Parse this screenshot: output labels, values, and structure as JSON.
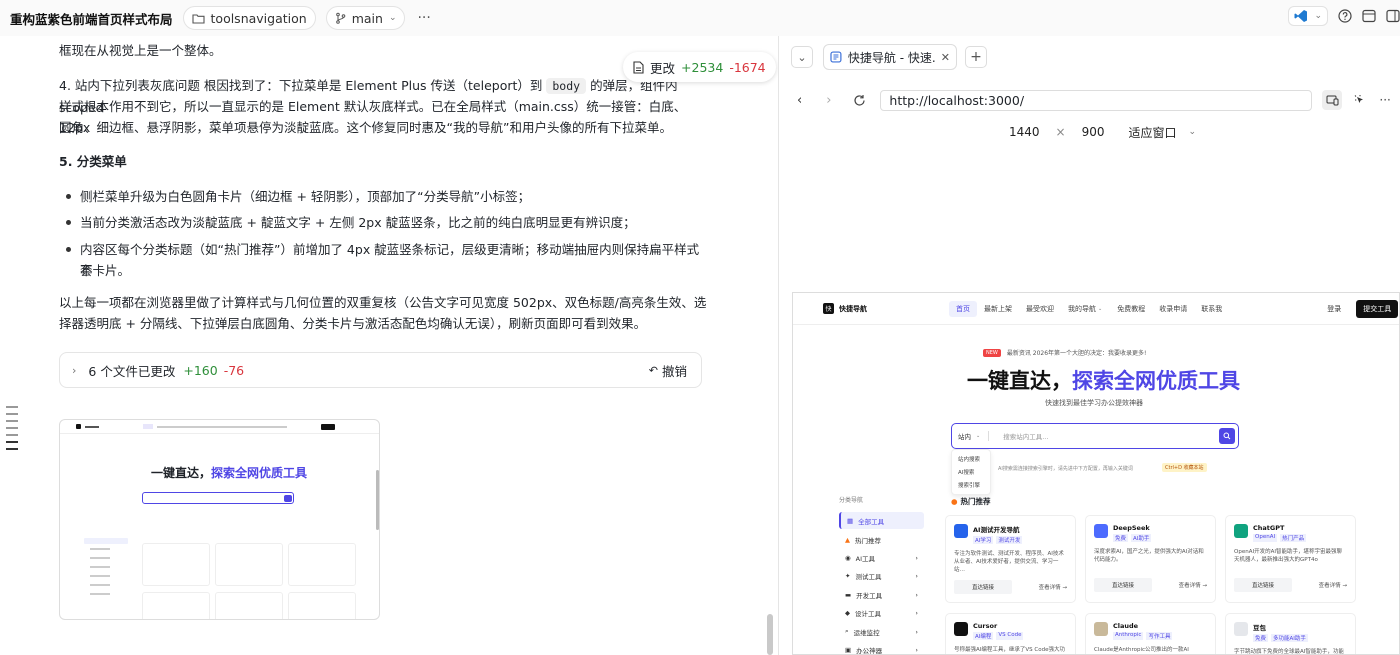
{
  "topbar": {
    "title": "重构蓝紫色前端首页样式布局",
    "folder": "toolsnavigation",
    "branch": "main",
    "more": "···"
  },
  "chat": {
    "p_top": "框现在从视觉上是一个整体。",
    "p4_label": "4. 站内下拉列表灰底问题",
    "p4_a": "根因找到了：下拉菜单是 Element Plus 传送（teleport）到",
    "p4_code": "body",
    "p4_b": "的弹层，组件内 scoped",
    "p4_line2": "样式根本作用不到它，所以一直显示的是 Element 默认灰底样式。已在全局样式（main.css）统一接管：白底、12px",
    "p4_line3": "圆角、细边框、悬浮阴影，菜单项悬停为淡靛蓝底。这个修复同时惠及“我的导航”和用户头像的所有下拉菜单。",
    "p5_label": "5. 分类菜单",
    "bullets": [
      "侧栏菜单升级为白色圆角卡片（细边框 + 轻阴影），顶部加了“分类导航”小标签；",
      "当前分类激活态改为淡靛蓝底 + 靛蓝文字 + 左侧 2px 靛蓝竖条，比之前的纯白底明显更有辨识度；",
      "内容区每个分类标题（如“热门推荐”）前增加了 4px 靛蓝竖条标记，层级更清晰；移动端抽屉内则保持扁平样式不",
      "套卡片。"
    ],
    "summary_line1": "以上每一项都在浏览器里做了计算样式与几何位置的双重复核（公告文字可见宽度 502px、双色标题/高亮条生效、选",
    "summary_line2": "择器透明底 + 分隔线、下拉弹层白底圆角、分类卡片与激活态配色均确认无误），刷新页面即可看到效果。",
    "changes_pill": {
      "label": "更改",
      "added": "+2534",
      "removed": "-1674"
    },
    "files_bar": {
      "label": "6 个文件已更改",
      "added": "+160",
      "removed": "-76",
      "undo": "撤销"
    }
  },
  "browser": {
    "tab_title": "快捷导航 - 快速.",
    "url": "http://localhost:3000/",
    "width": "1440",
    "times": "×",
    "height": "900",
    "fit": "适应窗口"
  },
  "site": {
    "logo": "快捷导航",
    "nav": [
      "首页",
      "最新上架",
      "最受欢迎",
      "我的导航",
      "免费教程",
      "收录申请",
      "联系我"
    ],
    "login": "登录",
    "submit": "提交工具",
    "badge": "NEW",
    "notice": "最新资讯  2026年第一个大胆的决定：我要收录更多!",
    "hero_a": "一键直达，",
    "hero_b": "探索全网优质工具",
    "subtitle": "快速找到最佳学习办公提效神器",
    "search_scope": "站内",
    "search_placeholder": "搜索站内工具...",
    "dropdown": [
      "站内搜索",
      "AI搜索",
      "搜索引擎"
    ],
    "hint": "AI搜索需连接搜索引擎时，请先进中下方配置，再输入关键词",
    "hotkey": "Ctrl+D 收藏本站",
    "section": "热门推荐",
    "sidebar_label": "分类导航",
    "categories": [
      "全部工具",
      "热门推荐",
      "AI工具",
      "测试工具",
      "开发工具",
      "设计工具",
      "运维监控",
      "办公神器"
    ],
    "cards": [
      {
        "name": "AI测试开发导航",
        "tags": [
          "AI学习",
          "测试开发"
        ],
        "desc": "专注为软件测试、测试开发、程序员、AI技术从业者、AI技术爱好者，提供交流、学习一站…",
        "btn": "直达链接",
        "more": "查看详情 →"
      },
      {
        "name": "DeepSeek",
        "tags": [
          "免费",
          "AI助手"
        ],
        "desc": "深度求索AI，国产之光，提供强大的AI对话和代码能力。",
        "btn": "直达链接",
        "more": "查看详情 →"
      },
      {
        "name": "ChatGPT",
        "tags": [
          "OpenAI",
          "热门产品"
        ],
        "desc": "OpenAI开发的AI智能助手，堪称宇宙最强聊天机器人，最新推出强大的GPT4o",
        "btn": "直达链接",
        "more": "查看详情 →"
      },
      {
        "name": "Cursor",
        "tags": [
          "AI编程",
          "VS Code"
        ],
        "desc": "号称最强AI编程工具，继承了VS Code强大功"
      },
      {
        "name": "Claude",
        "tags": [
          "Anthropic",
          "写作工具"
        ],
        "desc": "Claude是Anthropic公司推出的一款AI"
      },
      {
        "name": "豆包",
        "tags": [
          "免费",
          "多功能AI助手"
        ],
        "desc": "字节跳动旗下免费的全球最AI智能助手，功能全"
      }
    ]
  },
  "colors": {
    "accent": "#4f46e5",
    "added": "#2f8f3a",
    "removed": "#d9363e"
  }
}
